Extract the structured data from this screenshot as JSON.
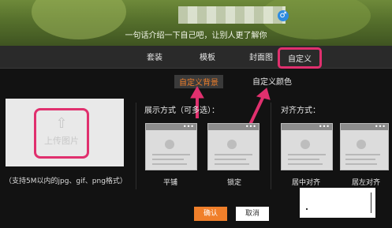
{
  "profile": {
    "gender_icon": "♂",
    "bio": "一句话介绍一下自己吧，让别人更了解你"
  },
  "tabs": [
    {
      "label": "套装",
      "active": false
    },
    {
      "label": "模板",
      "active": false
    },
    {
      "label": "封面图",
      "active": false
    },
    {
      "label": "自定义",
      "active": true
    }
  ],
  "subtabs": {
    "background": "自定义背景",
    "color": "自定义颜色"
  },
  "upload": {
    "icon": "upload-icon",
    "label": "上传图片",
    "note": "（支持5M以内的jpg、gif、png格式）"
  },
  "display_mode": {
    "label": "展示方式（可多选）：",
    "options": [
      "平铺",
      "锁定"
    ]
  },
  "alignment": {
    "label": "对齐方式：",
    "options": [
      "居中对齐",
      "居左对齐"
    ]
  },
  "actions": {
    "confirm": "确认",
    "cancel": "取消"
  },
  "colors": {
    "accent": "#f07f2a",
    "highlight": "#e0306e"
  }
}
